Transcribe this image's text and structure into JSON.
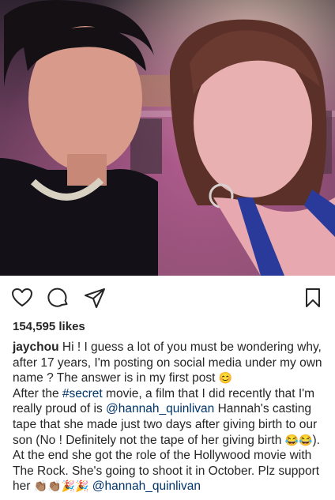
{
  "post": {
    "likes": "154,595 likes",
    "username": "jaychou",
    "caption_p1": " Hi ! I guess a lot of you must be wondering why, after 17 years, I'm posting on social media under my own name ? The answer is in my first post ",
    "caption_p1_emoji": "😊",
    "caption_p2_start": "After the ",
    "hashtag": "#secret",
    "caption_p2_mid": " movie, a film that I did recently that I'm really proud of is ",
    "mention_1": "@hannah_quinlivan",
    "caption_p2_end": " Hannah's casting tape that she made just two days after giving birth to our son (No ! Definitely not the tape of her giving birth ",
    "caption_p2_emoji": "😂😂",
    "caption_p2_close": ").",
    "caption_p3": "At the end she got the role of the Hollywood movie with The Rock. She's going to shoot it in October. Plz support her ",
    "caption_p3_emoji": "👏🏽👏🏽🎉🎉",
    "mention_2": "@hannah_quinlivan"
  },
  "icons": {
    "like": "heart-icon",
    "comment": "comment-bubble-icon",
    "share": "paper-plane-icon",
    "save": "bookmark-icon"
  }
}
